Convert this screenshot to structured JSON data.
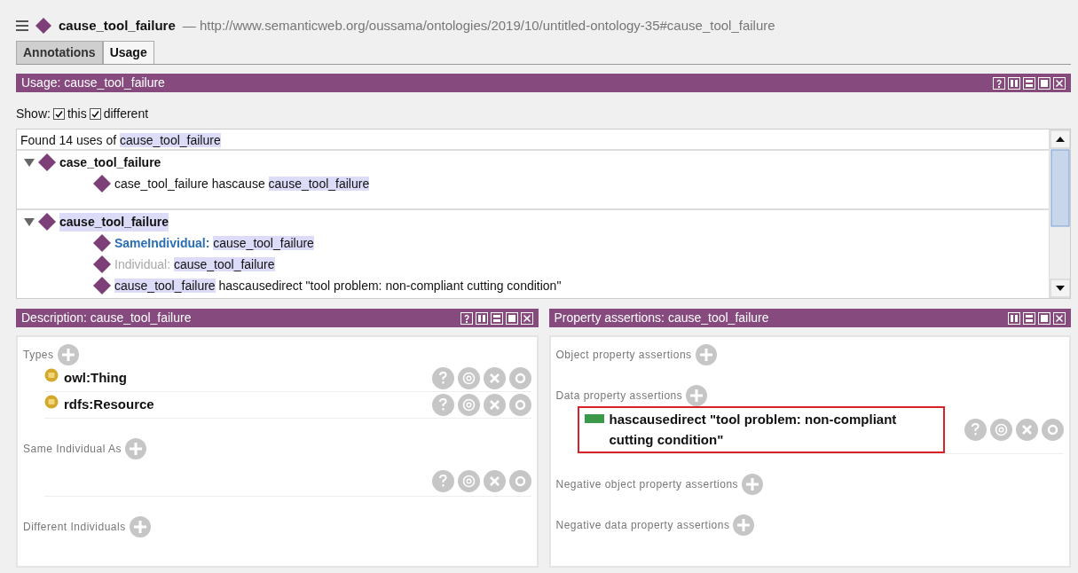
{
  "header": {
    "entity": "cause_tool_failure",
    "iri": "— http://www.semanticweb.org/oussama/ontologies/2019/10/untitled-ontology-35#cause_tool_failure"
  },
  "tabs": [
    {
      "label": "Annotations",
      "selected": false
    },
    {
      "label": "Usage",
      "selected": true
    }
  ],
  "usage": {
    "title": "Usage: cause_tool_failure",
    "has_help": true,
    "show_label": "Show:",
    "checkboxes": [
      {
        "label": "this",
        "checked": true
      },
      {
        "label": "different",
        "checked": true
      }
    ],
    "found": [
      {
        "text": "Found 14 uses of ",
        "kind": "plain"
      },
      {
        "text": "cause_tool_failure",
        "kind": "highlight"
      }
    ],
    "groups": [
      {
        "label": "case_tool_failure",
        "highlighted": false,
        "expanded": true,
        "children": [
          {
            "segments": [
              {
                "text": "case_tool_failure hascause ",
                "kind": "plain"
              },
              {
                "text": "cause_tool_failure",
                "kind": "highlight"
              }
            ]
          }
        ]
      },
      {
        "label": "cause_tool_failure",
        "highlighted": true,
        "expanded": true,
        "children": [
          {
            "segments": [
              {
                "text": "SameIndividual:",
                "kind": "keyword"
              },
              {
                "text": "cause_tool_failure",
                "kind": "highlight"
              }
            ]
          },
          {
            "segments": [
              {
                "text": "Individual:",
                "kind": "muted"
              },
              {
                "text": "cause_tool_failure",
                "kind": "highlight"
              }
            ]
          },
          {
            "segments": [
              {
                "text": "cause_tool_failure",
                "kind": "highlight"
              },
              {
                "text": " hascausedirect \"tool problem: non-compliant cutting condition\"",
                "kind": "plain"
              }
            ]
          }
        ]
      }
    ]
  },
  "panels": [
    {
      "title": "Description: cause_tool_failure",
      "has_help": true,
      "sections": [
        {
          "title": "Types",
          "items": [
            {
              "label": "owl:Thing",
              "kind": "class"
            },
            {
              "label": "rdfs:Resource",
              "kind": "class"
            }
          ]
        },
        {
          "title": "Same Individual As",
          "items": [
            {
              "kind": "blank"
            }
          ]
        },
        {
          "title": "Different Individuals"
        }
      ]
    },
    {
      "title": "Property assertions: cause_tool_failure",
      "has_help": false,
      "sections": [
        {
          "title": "Object property assertions"
        },
        {
          "title": "Data property assertions",
          "items": [
            {
              "label": "hascausedirect",
              "value": "\"tool problem: non-compliant cutting condition\"",
              "kind": "data",
              "selected": true
            }
          ]
        },
        {
          "title": "Negative object property assertions"
        },
        {
          "title": "Negative data property assertions"
        }
      ]
    }
  ]
}
